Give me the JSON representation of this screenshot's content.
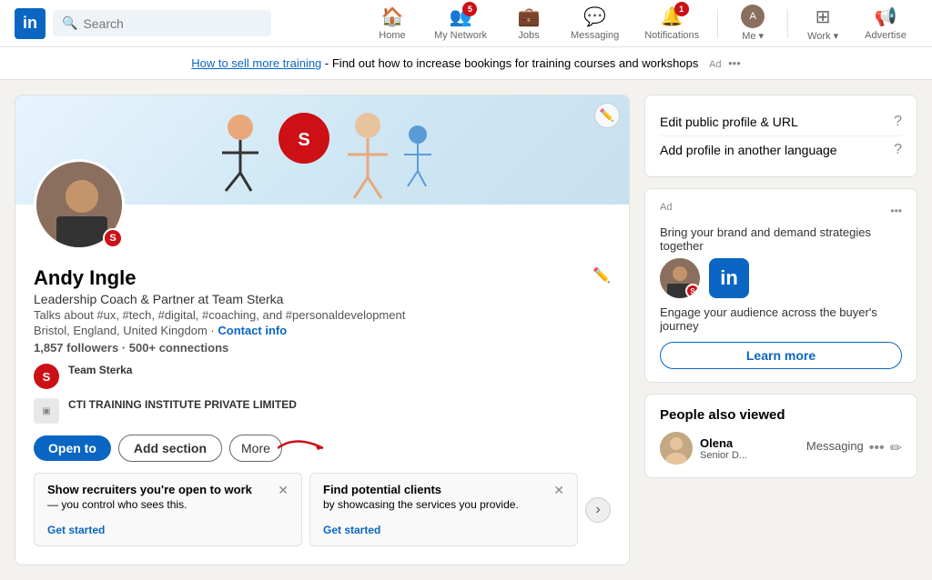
{
  "brand": {
    "logo_letter": "in"
  },
  "navbar": {
    "search_placeholder": "Search",
    "items": [
      {
        "id": "home",
        "label": "Home",
        "icon": "🏠",
        "badge": null,
        "active": false
      },
      {
        "id": "network",
        "label": "My Network",
        "icon": "👥",
        "badge": "5",
        "active": false
      },
      {
        "id": "jobs",
        "label": "Jobs",
        "icon": "💼",
        "badge": null,
        "active": false
      },
      {
        "id": "messaging",
        "label": "Messaging",
        "icon": "💬",
        "badge": null,
        "active": false
      },
      {
        "id": "notifications",
        "label": "Notifications",
        "icon": "🔔",
        "badge": "1",
        "active": false
      },
      {
        "id": "me",
        "label": "Me ▾",
        "icon": "avatar",
        "badge": null,
        "active": false
      },
      {
        "id": "work",
        "label": "Work ▾",
        "icon": "⊞",
        "badge": null,
        "active": false
      },
      {
        "id": "advertise",
        "label": "Advertise",
        "icon": "✱",
        "badge": null,
        "active": false
      }
    ]
  },
  "ad_banner": {
    "link_text": "How to sell more training",
    "description": " - Find out how to increase bookings for training courses and workshops",
    "ad_label": "Ad"
  },
  "profile": {
    "name": "Andy Ingle",
    "headline": "Leadership Coach & Partner at Team Sterka",
    "hashtags": "Talks about #ux, #tech, #digital, #coaching, and #personaldevelopment",
    "location": "Bristol, England, United Kingdom",
    "contact_link": "Contact info",
    "followers": "1,857 followers",
    "connections": "500+ connections",
    "separator": " · ",
    "companies": [
      {
        "name": "Team Sterka",
        "type": "circle",
        "letter": "S"
      },
      {
        "name": "CTI TRAINING INSTITUTE PRIVATE LIMITED",
        "type": "square"
      }
    ],
    "actions": {
      "open_to": "Open to",
      "add_section": "Add section",
      "more": "More"
    },
    "recruiter_card": {
      "title": "Show recruiters you're open to work",
      "subtitle": "— you control who sees this.",
      "cta": "Get started"
    },
    "clients_card": {
      "title": "Find potential clients",
      "subtitle": "by showcasing the services you provide.",
      "cta": "Get started"
    }
  },
  "sidebar": {
    "profile_tools": [
      {
        "label": "Edit public profile & URL"
      },
      {
        "label": "Add profile in another language"
      }
    ],
    "ad": {
      "label": "Ad",
      "title": "Bring your brand and demand strategies together",
      "sub": "Engage your audience across the buyer's journey",
      "cta": "Learn more"
    },
    "people_title": "People also viewed",
    "people": [
      {
        "name": "Olena",
        "role": "Senior D..."
      }
    ],
    "messaging_label": "Messaging"
  }
}
